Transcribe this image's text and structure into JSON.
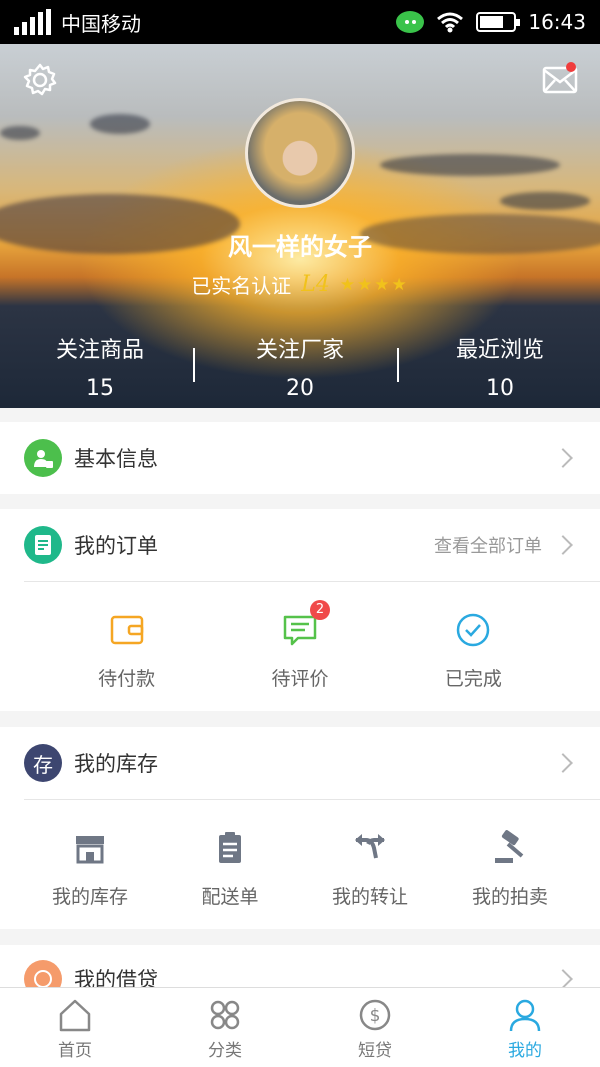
{
  "status_bar": {
    "carrier": "中国移动",
    "time": "16:43"
  },
  "profile": {
    "username": "风一样的女子",
    "verified_text": "已实名认证",
    "level": "L4",
    "stars": "★★★★",
    "stats": [
      {
        "label": "关注商品",
        "value": "15"
      },
      {
        "label": "关注厂家",
        "value": "20"
      },
      {
        "label": "最近浏览",
        "value": "10"
      }
    ]
  },
  "basic_info": {
    "label": "基本信息"
  },
  "orders": {
    "label": "我的订单",
    "view_all": "查看全部订单",
    "items": [
      {
        "label": "待付款"
      },
      {
        "label": "待评价",
        "badge": "2"
      },
      {
        "label": "已完成"
      }
    ]
  },
  "inventory": {
    "icon_text": "存",
    "label": "我的库存",
    "items": [
      {
        "label": "我的库存"
      },
      {
        "label": "配送单"
      },
      {
        "label": "我的转让"
      },
      {
        "label": "我的拍卖"
      }
    ]
  },
  "loans": {
    "label": "我的借贷"
  },
  "tabbar": {
    "tabs": [
      {
        "label": "首页"
      },
      {
        "label": "分类"
      },
      {
        "label": "短贷"
      },
      {
        "label": "我的"
      }
    ]
  },
  "colors": {
    "accent": "#2aa9e0",
    "badge": "#f04a4a",
    "star": "#f1c21b"
  }
}
